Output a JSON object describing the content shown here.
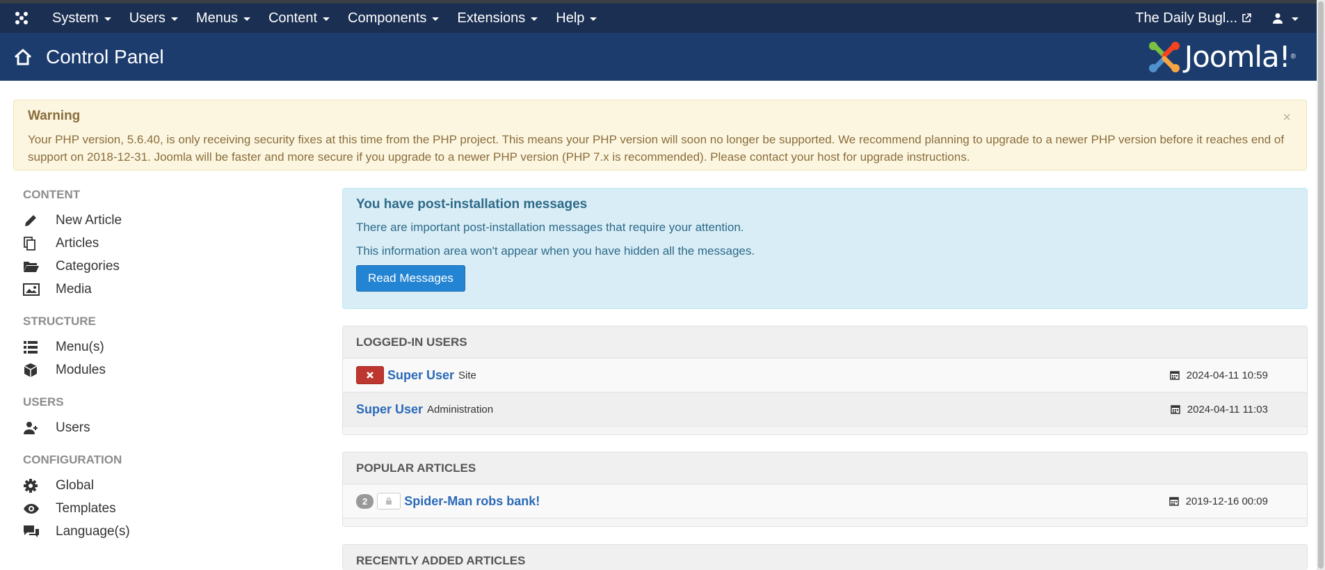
{
  "topbar": {
    "menus": [
      "System",
      "Users",
      "Menus",
      "Content",
      "Components",
      "Extensions",
      "Help"
    ],
    "site_link": "The Daily Bugl..."
  },
  "header": {
    "title": "Control Panel",
    "brand": "Joomla!",
    "brand_mark": "®"
  },
  "warning": {
    "title": "Warning",
    "text": "Your PHP version, 5.6.40, is only receiving security fixes at this time from the PHP project. This means your PHP version will soon no longer be supported. We recommend planning to upgrade to a newer PHP version before it reaches end of support on 2018-12-31. Joomla will be faster and more secure if you upgrade to a newer PHP version (PHP 7.x is recommended). Please contact your host for upgrade instructions.",
    "close": "×"
  },
  "sidebar": {
    "content_title": "CONTENT",
    "content_items": [
      "New Article",
      "Articles",
      "Categories",
      "Media"
    ],
    "structure_title": "STRUCTURE",
    "structure_items": [
      "Menu(s)",
      "Modules"
    ],
    "users_title": "USERS",
    "users_items": [
      "Users"
    ],
    "config_title": "CONFIGURATION",
    "config_items": [
      "Global",
      "Templates",
      "Language(s)"
    ]
  },
  "post_install": {
    "title": "You have post-installation messages",
    "line1": "There are important post-installation messages that require your attention.",
    "line2": "This information area won't appear when you have hidden all the messages.",
    "button": "Read Messages"
  },
  "logged_in": {
    "title": "LOGGED-IN USERS",
    "rows": [
      {
        "name": "Super User",
        "where": "Site",
        "date": "2024-04-11 10:59"
      },
      {
        "name": "Super User",
        "where": "Administration",
        "date": "2024-04-11 11:03"
      }
    ]
  },
  "popular": {
    "title": "POPULAR ARTICLES",
    "rows": [
      {
        "hits": "2",
        "title": "Spider-Man robs bank!",
        "date": "2019-12-16 00:09"
      }
    ]
  },
  "recent": {
    "title": "RECENTLY ADDED ARTICLES"
  },
  "colors": {
    "navbar": "#1b2f52",
    "header": "#1c3c6e",
    "link": "#2a69b8",
    "primary_button": "#2384d3",
    "danger_button": "#bd362f"
  }
}
